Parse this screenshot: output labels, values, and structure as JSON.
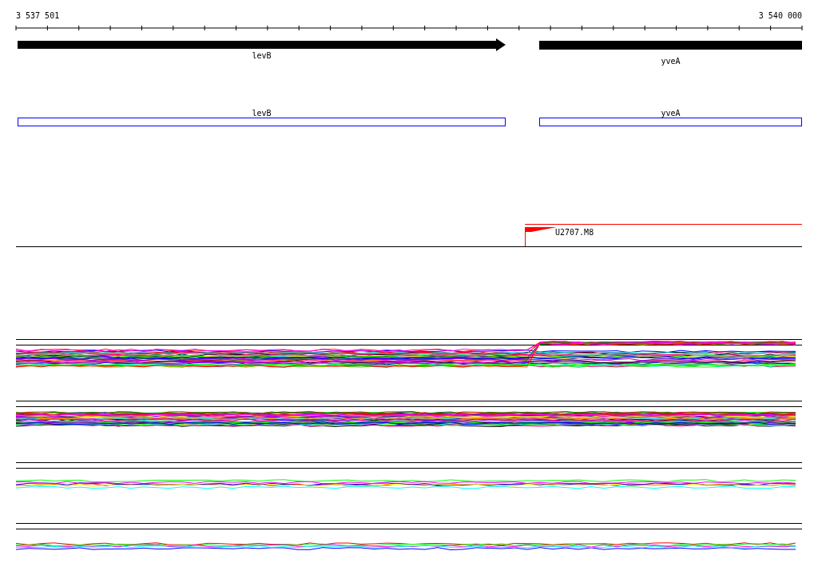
{
  "ruler": {
    "start_label": "3 537 501",
    "end_label": "3 540 000"
  },
  "gene_track": {
    "genes": [
      {
        "name": "levB",
        "kind": "arrow"
      },
      {
        "name": "yveA",
        "kind": "block"
      }
    ]
  },
  "annotation_track": {
    "features": [
      {
        "name": "levB"
      },
      {
        "name": "yveA"
      }
    ]
  },
  "marker_track": {
    "markers": [
      {
        "label": "U2707.M8"
      }
    ]
  }
}
